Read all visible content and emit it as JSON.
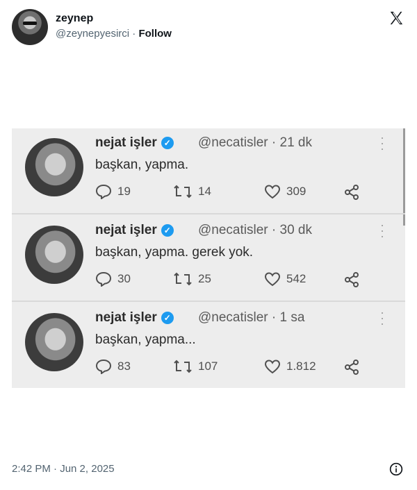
{
  "author": {
    "display_name": "zeynep",
    "handle": "@zeynepyesirci",
    "separator": " · ",
    "follow_label": "Follow"
  },
  "embedded_tweets": [
    {
      "name": "nejat işler",
      "handle": "@necatisler",
      "time": "· 21 dk",
      "text": "başkan, yapma.",
      "replies": "19",
      "retweets": "14",
      "likes": "309"
    },
    {
      "name": "nejat işler",
      "handle": "@necatisler",
      "time": "· 30 dk",
      "text": "başkan, yapma. gerek yok.",
      "replies": "30",
      "retweets": "25",
      "likes": "542"
    },
    {
      "name": "nejat işler",
      "handle": "@necatisler",
      "time": "· 1 sa",
      "text": "başkan, yapma...",
      "replies": "83",
      "retweets": "107",
      "likes": "1.812"
    }
  ],
  "footer": {
    "timestamp": "2:42 PM · Jun 2, 2025"
  },
  "icons": {
    "logo": "x-logo-icon",
    "verified": "verified-badge-icon",
    "info": "info-icon"
  },
  "colors": {
    "verified_blue": "#1d9bf0",
    "muted_text": "#536471"
  }
}
